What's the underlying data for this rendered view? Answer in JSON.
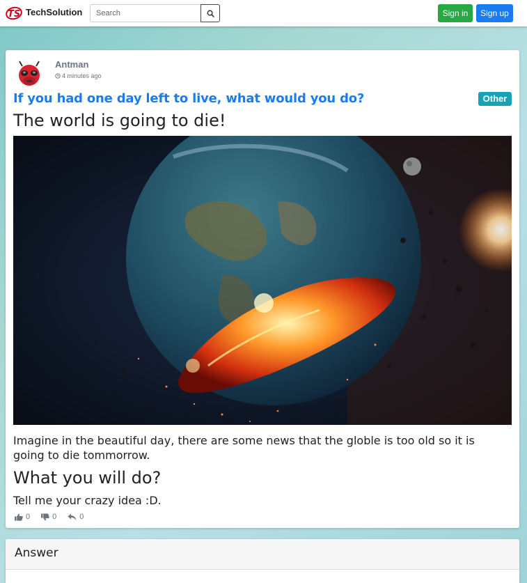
{
  "navbar": {
    "brand": "TechSolution",
    "search_placeholder": "Search",
    "signin_label": "Sign in",
    "signup_label": "Sign up",
    "colors": {
      "signin": "#28a745",
      "signup": "#1a7cf0"
    }
  },
  "post": {
    "author": "Antman",
    "time": "4 minutes ago",
    "question": "If you had one day left to live, what would you do?",
    "category": "Other",
    "headline": "The world is going to die!",
    "body": "Imagine in the beautiful day, there are some news that the globle is too old so it is going to die tommorrow.",
    "subheading": "What you will do?",
    "closing": "Tell me your crazy idea :D.",
    "likes": "0",
    "dislikes": "0",
    "replies": "0",
    "accent_color": "#1a7cf0",
    "badge_color": "#17a2b8"
  },
  "answer": {
    "title": "Answer"
  }
}
